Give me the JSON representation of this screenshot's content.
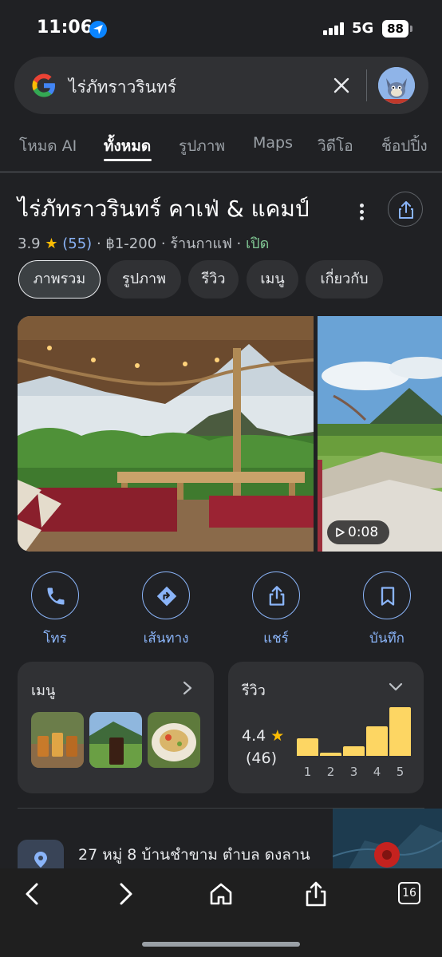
{
  "status": {
    "time": "11:06",
    "network": "5G",
    "battery": "88"
  },
  "search": {
    "query": "ไร่ภัทราวรินทร์"
  },
  "tabs": [
    {
      "label": "โหมด AI"
    },
    {
      "label": "ทั้งหมด"
    },
    {
      "label": "รูปภาพ"
    },
    {
      "label": "Maps"
    },
    {
      "label": "วิดีโอ"
    },
    {
      "label": "ช็อปปิ้ง"
    }
  ],
  "place": {
    "title": "ไร่ภัทราวรินทร์ คาเฟ่ & แคมป์",
    "rating": "3.9",
    "star": "★",
    "reviews": "(55)",
    "price": "฿1-200",
    "category": "ร้านกาแฟ",
    "status": "เปิด",
    "sep": "·"
  },
  "chips": [
    {
      "label": "ภาพรวม"
    },
    {
      "label": "รูปภาพ"
    },
    {
      "label": "รีวิว"
    },
    {
      "label": "เมนู"
    },
    {
      "label": "เกี่ยวกับ"
    }
  ],
  "video": {
    "duration": "0:08"
  },
  "actions": [
    {
      "label": "โทร",
      "icon": "phone-icon"
    },
    {
      "label": "เส้นทาง",
      "icon": "directions-icon"
    },
    {
      "label": "แชร์",
      "icon": "share-icon"
    },
    {
      "label": "บันทึก",
      "icon": "bookmark-icon"
    }
  ],
  "menu_card": {
    "title": "เมนู"
  },
  "review_card": {
    "title": "รีวิว",
    "rating": "4.4",
    "star": "★",
    "count": "(46)",
    "distribution": [
      {
        "stars": "1",
        "fraction": 0.33
      },
      {
        "stars": "2",
        "fraction": 0.06
      },
      {
        "stars": "3",
        "fraction": 0.17
      },
      {
        "stars": "4",
        "fraction": 0.55
      },
      {
        "stars": "5",
        "fraction": 0.9
      }
    ]
  },
  "address": {
    "text": "27 หมู่ 8 บ้านชำขาม ตำบล ดงลาน"
  },
  "browser": {
    "tab_count": "16"
  },
  "colors": {
    "accent": "#8ab4f8",
    "star": "#fbbc04",
    "open": "#81c995",
    "bar": "#fdd663"
  }
}
